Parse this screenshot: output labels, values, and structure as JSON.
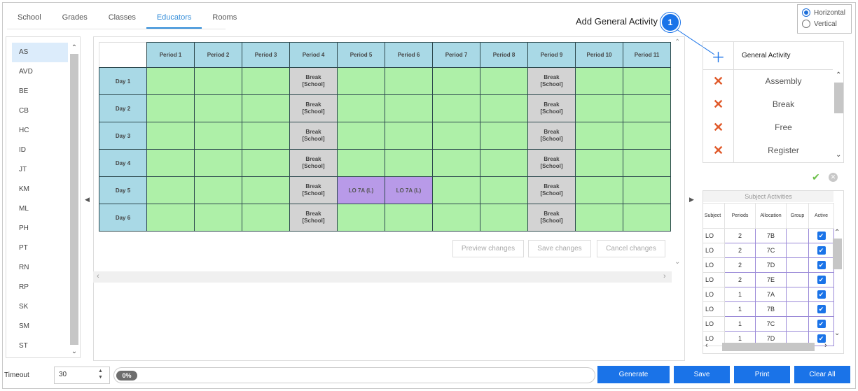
{
  "tabs": [
    "School",
    "Grades",
    "Classes",
    "Educators",
    "Rooms"
  ],
  "active_tab_index": 3,
  "orientation": {
    "options": [
      "Horizontal",
      "Vertical"
    ],
    "selected": "Horizontal"
  },
  "callout": {
    "label": "Add General Activity",
    "number": "1"
  },
  "educators": {
    "items": [
      "AS",
      "AVD",
      "BE",
      "CB",
      "HC",
      "ID",
      "JT",
      "KM",
      "ML",
      "PH",
      "PT",
      "RN",
      "RP",
      "SK",
      "SM",
      "ST"
    ],
    "selected": "AS"
  },
  "timetable": {
    "periods": [
      "Period 1",
      "Period 2",
      "Period 3",
      "Period 4",
      "Period 5",
      "Period 6",
      "Period 7",
      "Period 8",
      "Period 9",
      "Period 10",
      "Period 11"
    ],
    "days": [
      "Day 1",
      "Day 2",
      "Day 3",
      "Day 4",
      "Day 5",
      "Day 6"
    ],
    "break_text": "Break [School]",
    "break_periods": [
      "Period 4",
      "Period 9"
    ],
    "lesson": {
      "text": "LO 7A (L)",
      "day": "Day 5",
      "periods": [
        "Period 5",
        "Period 6"
      ]
    }
  },
  "grid_buttons": {
    "preview": "Preview changes",
    "save": "Save changes",
    "cancel": "Cancel changes"
  },
  "general_activity": {
    "header": "General Activity",
    "items": [
      "Assembly",
      "Break",
      "Free",
      "Register"
    ]
  },
  "subject_activities": {
    "title": "Subject Activities",
    "columns": [
      "Subject",
      "Periods",
      "Allocation",
      "Group",
      "Active"
    ],
    "rows": [
      {
        "subject": "LO",
        "periods": "2",
        "allocation": "7B",
        "group": "",
        "active": true
      },
      {
        "subject": "LO",
        "periods": "2",
        "allocation": "7C",
        "group": "",
        "active": true
      },
      {
        "subject": "LO",
        "periods": "2",
        "allocation": "7D",
        "group": "",
        "active": true
      },
      {
        "subject": "LO",
        "periods": "2",
        "allocation": "7E",
        "group": "",
        "active": true
      },
      {
        "subject": "LO",
        "periods": "1",
        "allocation": "7A",
        "group": "",
        "active": true
      },
      {
        "subject": "LO",
        "periods": "1",
        "allocation": "7B",
        "group": "",
        "active": true
      },
      {
        "subject": "LO",
        "periods": "1",
        "allocation": "7C",
        "group": "",
        "active": true
      },
      {
        "subject": "LO",
        "periods": "1",
        "allocation": "7D",
        "group": "",
        "active": true
      }
    ]
  },
  "timeout": {
    "label": "Timeout",
    "value": "30"
  },
  "progress": {
    "text": "0%",
    "fraction": 0
  },
  "bottom_buttons": {
    "generate": "Generate",
    "save": "Save",
    "print": "Print",
    "clear_all": "Clear All"
  },
  "colors": {
    "accent": "#1a73e8",
    "day_header": "#a9d9e6",
    "free_slot": "#aef0a8",
    "break_slot": "#d3d3d3",
    "lesson_slot": "#b89ae8",
    "remove_icon": "#e05a2b"
  }
}
